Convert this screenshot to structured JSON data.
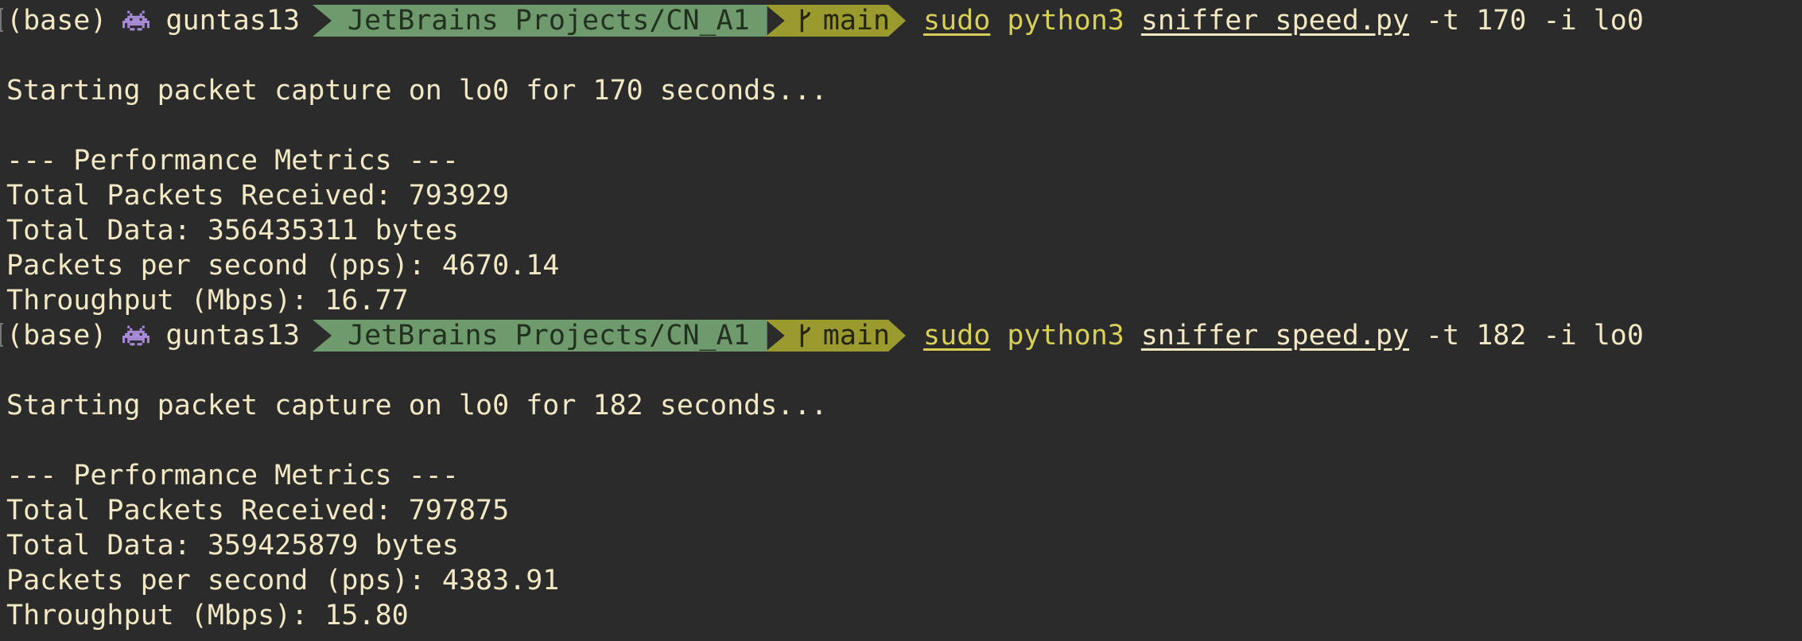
{
  "colors": {
    "background": "#2b2b2b",
    "text": "#f2e8c4",
    "dir_segment": "#6e9a6e",
    "git_segment": "#9b9a2e",
    "command_highlight": "#d7cf56"
  },
  "prompts": [
    {
      "env": "(base)",
      "user_icon": "alien-icon",
      "user": "guntas13",
      "dir": "JetBrains Projects/CN_A1",
      "branch_icon": "git-branch-icon",
      "branch": "main",
      "cmd_sudo": "sudo",
      "cmd_python": "python3",
      "cmd_file": "sniffer_speed.py",
      "cmd_args": "-t 170 -i lo0",
      "output": {
        "start": "Starting packet capture on lo0 for 170 seconds...",
        "header": "--- Performance Metrics ---",
        "packets": "Total Packets Received: 793929",
        "data": "Total Data: 356435311 bytes",
        "pps": "Packets per second (pps): 4670.14",
        "throughput": "Throughput (Mbps): 16.77"
      }
    },
    {
      "env": "(base)",
      "user_icon": "alien-icon",
      "user": "guntas13",
      "dir": "JetBrains Projects/CN_A1",
      "branch_icon": "git-branch-icon",
      "branch": "main",
      "cmd_sudo": "sudo",
      "cmd_python": "python3",
      "cmd_file": "sniffer_speed.py",
      "cmd_args": "-t 182 -i lo0",
      "output": {
        "start": "Starting packet capture on lo0 for 182 seconds...",
        "header": "--- Performance Metrics ---",
        "packets": "Total Packets Received: 797875",
        "data": "Total Data: 359425879 bytes",
        "pps": "Packets per second (pps): 4383.91",
        "throughput": "Throughput (Mbps): 15.80"
      }
    }
  ]
}
